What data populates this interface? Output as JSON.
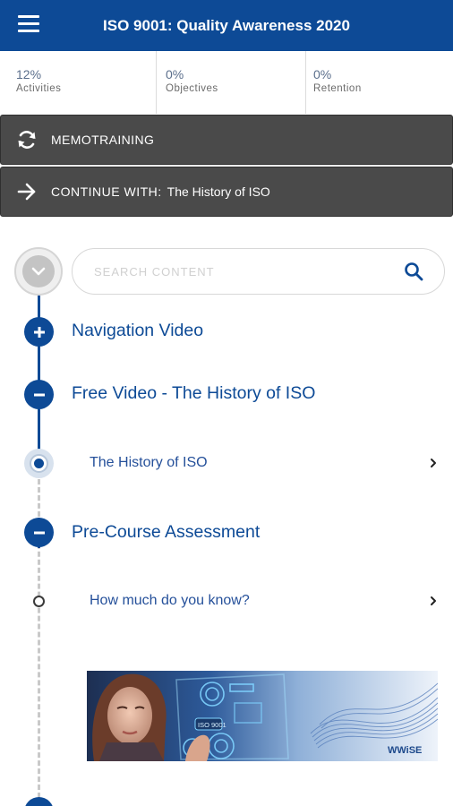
{
  "header": {
    "title": "ISO 9001: Quality Awareness 2020",
    "menu_icon": "hamburger-menu-icon"
  },
  "stats": [
    {
      "value": "12%",
      "label": "Activities"
    },
    {
      "value": "0%",
      "label": "Objectives"
    },
    {
      "value": "0%",
      "label": "Retention"
    }
  ],
  "memotraining": {
    "label": "MEMOTRAINING",
    "icon": "refresh-icon"
  },
  "continue": {
    "label": "CONTINUE WITH:",
    "item": "The History of ISO",
    "icon": "arrow-right-icon"
  },
  "search": {
    "placeholder": "SEARCH CONTENT",
    "value": "",
    "icon": "search-icon"
  },
  "sections": [
    {
      "title": "Navigation Video",
      "state": "collapsed",
      "icon": "plus-icon"
    },
    {
      "title": "Free Video - The History of ISO",
      "state": "expanded",
      "icon": "minus-icon",
      "items": [
        {
          "label": "The History of ISO",
          "status": "current"
        }
      ]
    },
    {
      "title": "Pre-Course Assessment",
      "state": "expanded",
      "icon": "minus-icon",
      "items": [
        {
          "label": "How much do you know?",
          "status": "not-started"
        }
      ]
    }
  ],
  "banner": {
    "chip_text": "ISO 9001",
    "logo_text": "WWiSE"
  },
  "colors": {
    "brand_blue": "#0d4a96",
    "dark_button": "#4a4a4a",
    "link_blue": "#25509a"
  }
}
